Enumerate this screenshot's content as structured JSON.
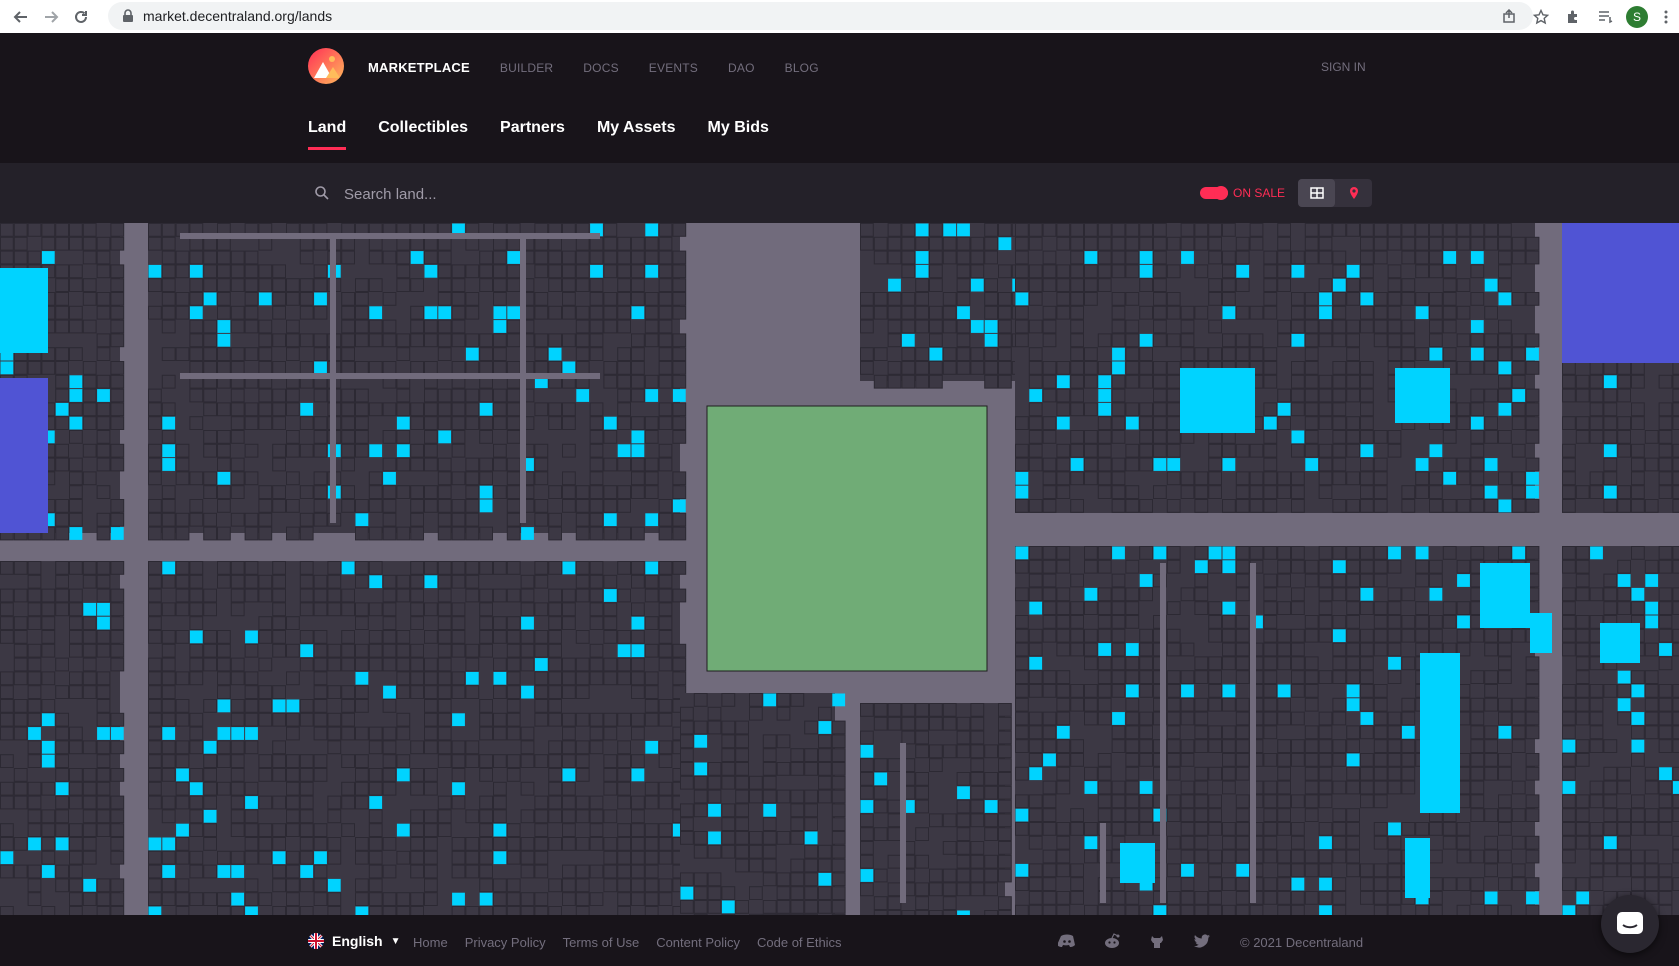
{
  "browser": {
    "url": "market.decentraland.org/lands",
    "profile_initial": "S"
  },
  "header": {
    "nav": [
      "MARKETPLACE",
      "BUILDER",
      "DOCS",
      "EVENTS",
      "DAO",
      "BLOG"
    ],
    "signin": "SIGN IN",
    "tabs": [
      "Land",
      "Collectibles",
      "Partners",
      "My Assets",
      "My Bids"
    ]
  },
  "search": {
    "placeholder": "Search land...",
    "on_sale_label": "ON SALE"
  },
  "colors": {
    "accent": "#ff2d55",
    "parcel": "#3c3844",
    "road": "#716b7c",
    "on_sale": "#00d3ff",
    "plaza": "#70ac76",
    "district": "#5054d4"
  },
  "footer": {
    "language": "English",
    "links": [
      "Home",
      "Privacy Policy",
      "Terms of Use",
      "Content Policy",
      "Code of Ethics"
    ],
    "copyright": "© 2021 Decentraland"
  }
}
